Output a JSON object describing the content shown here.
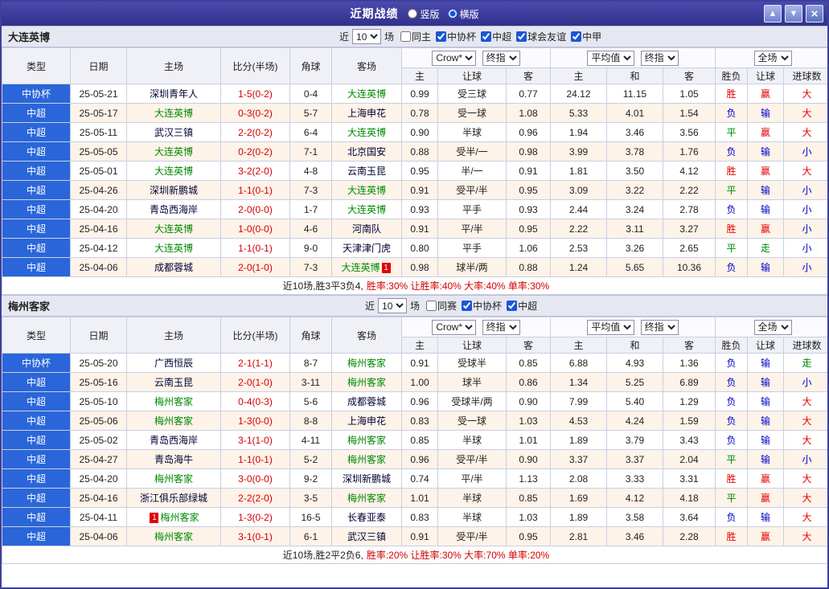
{
  "titlebar": {
    "title": "近期战绩",
    "layout_options": [
      {
        "label": "竖版",
        "selected": false
      },
      {
        "label": "横版",
        "selected": true
      }
    ],
    "icons": {
      "up": "▲",
      "down": "▼",
      "close": "×"
    }
  },
  "columns": {
    "left": [
      "类型",
      "日期",
      "主场",
      "比分(半场)",
      "角球",
      "客场"
    ],
    "asia": [
      "主",
      "让球",
      "客"
    ],
    "europe": [
      "主",
      "和",
      "客"
    ],
    "result": [
      "胜负",
      "让球",
      "进球数"
    ]
  },
  "sections": [
    {
      "team": "大连英博",
      "filters": {
        "near_label": "近",
        "count": "10",
        "games_label": "场",
        "checkboxes": [
          {
            "label": "同主",
            "checked": false
          },
          {
            "label": "中协杯",
            "checked": true
          },
          {
            "label": "中超",
            "checked": true
          },
          {
            "label": "球会友谊",
            "checked": true
          },
          {
            "label": "中甲",
            "checked": true
          }
        ]
      },
      "selects": {
        "asia_source": "Crow*",
        "asia_time": "终指",
        "europe_source": "平均值",
        "europe_time": "终指",
        "scope": "全场"
      },
      "rows": [
        {
          "type": "中协杯",
          "date": "25-05-21",
          "home": "深圳青年人",
          "score": "1-5(0-2)",
          "corners": "0-4",
          "away": "大连英博",
          "away_focus": true,
          "asia_home": "0.99",
          "handicap": "受三球",
          "asia_away": "0.77",
          "eu_home": "24.12",
          "eu_draw": "11.15",
          "eu_away": "1.05",
          "result": "胜",
          "handicap_result": "赢",
          "goals": "大"
        },
        {
          "type": "中超",
          "date": "25-05-17",
          "home": "大连英博",
          "home_focus": true,
          "score": "0-3(0-2)",
          "corners": "5-7",
          "away": "上海申花",
          "asia_home": "0.78",
          "handicap": "受一球",
          "asia_away": "1.08",
          "eu_home": "5.33",
          "eu_draw": "4.01",
          "eu_away": "1.54",
          "result": "负",
          "handicap_result": "输",
          "goals": "大"
        },
        {
          "type": "中超",
          "date": "25-05-11",
          "home": "武汉三镇",
          "score": "2-2(0-2)",
          "corners": "6-4",
          "away": "大连英博",
          "away_focus": true,
          "asia_home": "0.90",
          "handicap": "半球",
          "asia_away": "0.96",
          "eu_home": "1.94",
          "eu_draw": "3.46",
          "eu_away": "3.56",
          "result": "平",
          "handicap_result": "赢",
          "goals": "大"
        },
        {
          "type": "中超",
          "date": "25-05-05",
          "home": "大连英博",
          "home_focus": true,
          "score": "0-2(0-2)",
          "corners": "7-1",
          "away": "北京国安",
          "asia_home": "0.88",
          "handicap": "受半/一",
          "asia_away": "0.98",
          "eu_home": "3.99",
          "eu_draw": "3.78",
          "eu_away": "1.76",
          "result": "负",
          "handicap_result": "输",
          "goals": "小"
        },
        {
          "type": "中超",
          "date": "25-05-01",
          "home": "大连英博",
          "home_focus": true,
          "score": "3-2(2-0)",
          "corners": "4-8",
          "away": "云南玉昆",
          "asia_home": "0.95",
          "handicap": "半/一",
          "asia_away": "0.91",
          "eu_home": "1.81",
          "eu_draw": "3.50",
          "eu_away": "4.12",
          "result": "胜",
          "handicap_result": "赢",
          "goals": "大"
        },
        {
          "type": "中超",
          "date": "25-04-26",
          "home": "深圳新鹏城",
          "score": "1-1(0-1)",
          "corners": "7-3",
          "away": "大连英博",
          "away_focus": true,
          "asia_home": "0.91",
          "handicap": "受平/半",
          "asia_away": "0.95",
          "eu_home": "3.09",
          "eu_draw": "3.22",
          "eu_away": "2.22",
          "result": "平",
          "handicap_result": "输",
          "goals": "小"
        },
        {
          "type": "中超",
          "date": "25-04-20",
          "home": "青岛西海岸",
          "score": "2-0(0-0)",
          "corners": "1-7",
          "away": "大连英博",
          "away_focus": true,
          "asia_home": "0.93",
          "handicap": "平手",
          "asia_away": "0.93",
          "eu_home": "2.44",
          "eu_draw": "3.24",
          "eu_away": "2.78",
          "result": "负",
          "handicap_result": "输",
          "goals": "小"
        },
        {
          "type": "中超",
          "date": "25-04-16",
          "home": "大连英博",
          "home_focus": true,
          "score": "1-0(0-0)",
          "corners": "4-6",
          "away": "河南队",
          "asia_home": "0.91",
          "handicap": "平/半",
          "asia_away": "0.95",
          "eu_home": "2.22",
          "eu_draw": "3.11",
          "eu_away": "3.27",
          "result": "胜",
          "handicap_result": "赢",
          "goals": "小"
        },
        {
          "type": "中超",
          "date": "25-04-12",
          "home": "大连英博",
          "home_focus": true,
          "score": "1-1(0-1)",
          "corners": "9-0",
          "away": "天津津门虎",
          "asia_home": "0.80",
          "handicap": "平手",
          "asia_away": "1.06",
          "eu_home": "2.53",
          "eu_draw": "3.26",
          "eu_away": "2.65",
          "result": "平",
          "handicap_result": "走",
          "goals": "小"
        },
        {
          "type": "中超",
          "date": "25-04-06",
          "home": "成都蓉城",
          "score": "2-0(1-0)",
          "corners": "7-3",
          "away": "大连英博",
          "away_focus": true,
          "away_card": "1",
          "asia_home": "0.98",
          "handicap": "球半/两",
          "asia_away": "0.88",
          "eu_home": "1.24",
          "eu_draw": "5.65",
          "eu_away": "10.36",
          "result": "负",
          "handicap_result": "输",
          "goals": "小"
        }
      ],
      "summary": {
        "record": "近10场,胜3平3负4,",
        "rates": "胜率:30% 让胜率:40% 大率:40% 单率:30%"
      }
    },
    {
      "team": "梅州客家",
      "filters": {
        "near_label": "近",
        "count": "10",
        "games_label": "场",
        "checkboxes": [
          {
            "label": "同赛",
            "checked": false
          },
          {
            "label": "中协杯",
            "checked": true
          },
          {
            "label": "中超",
            "checked": true
          }
        ]
      },
      "selects": {
        "asia_source": "Crow*",
        "asia_time": "终指",
        "europe_source": "平均值",
        "europe_time": "终指",
        "scope": "全场"
      },
      "rows": [
        {
          "type": "中协杯",
          "date": "25-05-20",
          "home": "广西恒辰",
          "score": "2-1(1-1)",
          "corners": "8-7",
          "away": "梅州客家",
          "away_focus": true,
          "asia_home": "0.91",
          "handicap": "受球半",
          "asia_away": "0.85",
          "eu_home": "6.88",
          "eu_draw": "4.93",
          "eu_away": "1.36",
          "result": "负",
          "handicap_result": "输",
          "goals": "走"
        },
        {
          "type": "中超",
          "date": "25-05-16",
          "home": "云南玉昆",
          "score": "2-0(1-0)",
          "corners": "3-11",
          "away": "梅州客家",
          "away_focus": true,
          "asia_home": "1.00",
          "handicap": "球半",
          "asia_away": "0.86",
          "eu_home": "1.34",
          "eu_draw": "5.25",
          "eu_away": "6.89",
          "result": "负",
          "handicap_result": "输",
          "goals": "小"
        },
        {
          "type": "中超",
          "date": "25-05-10",
          "home": "梅州客家",
          "home_focus": true,
          "score": "0-4(0-3)",
          "corners": "5-6",
          "away": "成都蓉城",
          "asia_home": "0.96",
          "handicap": "受球半/两",
          "asia_away": "0.90",
          "eu_home": "7.99",
          "eu_draw": "5.40",
          "eu_away": "1.29",
          "result": "负",
          "handicap_result": "输",
          "goals": "大"
        },
        {
          "type": "中超",
          "date": "25-05-06",
          "home": "梅州客家",
          "home_focus": true,
          "score": "1-3(0-0)",
          "corners": "8-8",
          "away": "上海申花",
          "asia_home": "0.83",
          "handicap": "受一球",
          "asia_away": "1.03",
          "eu_home": "4.53",
          "eu_draw": "4.24",
          "eu_away": "1.59",
          "result": "负",
          "handicap_result": "输",
          "goals": "大"
        },
        {
          "type": "中超",
          "date": "25-05-02",
          "home": "青岛西海岸",
          "score": "3-1(1-0)",
          "corners": "4-11",
          "away": "梅州客家",
          "away_focus": true,
          "asia_home": "0.85",
          "handicap": "半球",
          "asia_away": "1.01",
          "eu_home": "1.89",
          "eu_draw": "3.79",
          "eu_away": "3.43",
          "result": "负",
          "handicap_result": "输",
          "goals": "大"
        },
        {
          "type": "中超",
          "date": "25-04-27",
          "home": "青岛海牛",
          "score": "1-1(0-1)",
          "corners": "5-2",
          "away": "梅州客家",
          "away_focus": true,
          "asia_home": "0.96",
          "handicap": "受平/半",
          "asia_away": "0.90",
          "eu_home": "3.37",
          "eu_draw": "3.37",
          "eu_away": "2.04",
          "result": "平",
          "handicap_result": "输",
          "goals": "小"
        },
        {
          "type": "中超",
          "date": "25-04-20",
          "home": "梅州客家",
          "home_focus": true,
          "score": "3-0(0-0)",
          "corners": "9-2",
          "away": "深圳新鹏城",
          "asia_home": "0.74",
          "handicap": "平/半",
          "asia_away": "1.13",
          "eu_home": "2.08",
          "eu_draw": "3.33",
          "eu_away": "3.31",
          "result": "胜",
          "handicap_result": "赢",
          "goals": "大"
        },
        {
          "type": "中超",
          "date": "25-04-16",
          "home": "浙江俱乐部绿城",
          "score": "2-2(2-0)",
          "corners": "3-5",
          "away": "梅州客家",
          "away_focus": true,
          "asia_home": "1.01",
          "handicap": "半球",
          "asia_away": "0.85",
          "eu_home": "1.69",
          "eu_draw": "4.12",
          "eu_away": "4.18",
          "result": "平",
          "handicap_result": "赢",
          "goals": "大"
        },
        {
          "type": "中超",
          "date": "25-04-11",
          "home": "梅州客家",
          "home_focus": true,
          "home_card": "1",
          "score": "1-3(0-2)",
          "corners": "16-5",
          "away": "长春亚泰",
          "asia_home": "0.83",
          "handicap": "半球",
          "asia_away": "1.03",
          "eu_home": "1.89",
          "eu_draw": "3.58",
          "eu_away": "3.64",
          "result": "负",
          "handicap_result": "输",
          "goals": "大"
        },
        {
          "type": "中超",
          "date": "25-04-06",
          "home": "梅州客家",
          "home_focus": true,
          "score": "3-1(0-1)",
          "corners": "6-1",
          "away": "武汉三镇",
          "asia_home": "0.91",
          "handicap": "受平/半",
          "asia_away": "0.95",
          "eu_home": "2.81",
          "eu_draw": "3.46",
          "eu_away": "2.28",
          "result": "胜",
          "handicap_result": "赢",
          "goals": "大"
        }
      ],
      "summary": {
        "record": "近10场,胜2平2负6,",
        "rates": "胜率:20% 让胜率:30% 大率:70% 单率:20%"
      }
    }
  ]
}
